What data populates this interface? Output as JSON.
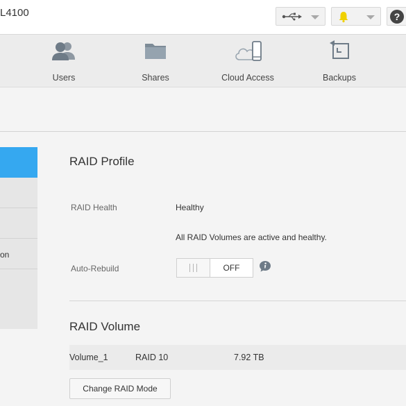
{
  "header": {
    "device_name": "L4100",
    "icons": {
      "usb": "usb-icon",
      "alerts": "bell-icon",
      "help": "help-icon"
    },
    "help_glyph": "?"
  },
  "nav": {
    "items": [
      {
        "label": "Users",
        "icon": "users-icon"
      },
      {
        "label": "Shares",
        "icon": "folder-icon"
      },
      {
        "label": "Cloud Access",
        "icon": "cloud-device-icon"
      },
      {
        "label": "Backups",
        "icon": "backup-icon"
      }
    ]
  },
  "sidebar": {
    "items": [
      {
        "label": "",
        "active": true
      },
      {
        "label": "",
        "active": false
      },
      {
        "label": "",
        "active": false
      },
      {
        "label": "on",
        "active": false
      }
    ]
  },
  "raid_profile": {
    "title": "RAID Profile",
    "health_label": "RAID Health",
    "health_value": "Healthy",
    "health_detail": "All RAID Volumes are active and healthy.",
    "auto_rebuild_label": "Auto-Rebuild",
    "auto_rebuild_state": "OFF",
    "toggle_handle_glyph": "|||"
  },
  "raid_volume": {
    "title": "RAID Volume",
    "volumes": [
      {
        "name": "Volume_1",
        "mode": "RAID 10",
        "size": "7.92 TB"
      }
    ],
    "change_button": "Change RAID Mode"
  },
  "colors": {
    "accent": "#35a8f0",
    "alert": "#f0d100",
    "background": "#f4f4f4"
  }
}
